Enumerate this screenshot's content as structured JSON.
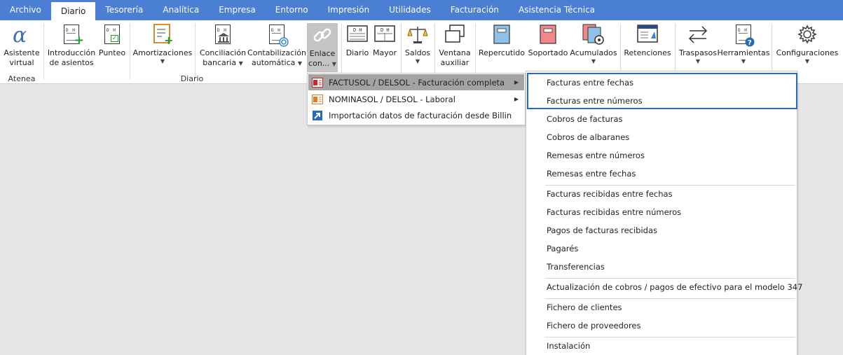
{
  "menubar": {
    "tabs": [
      {
        "label": "Archivo"
      },
      {
        "label": "Diario",
        "active": true
      },
      {
        "label": "Tesorería"
      },
      {
        "label": "Analítica"
      },
      {
        "label": "Empresa"
      },
      {
        "label": "Entorno"
      },
      {
        "label": "Impresión"
      },
      {
        "label": "Utilidades"
      },
      {
        "label": "Facturación"
      },
      {
        "label": "Asistencia Técnica"
      }
    ]
  },
  "ribbon": {
    "groups": {
      "atenea": "Atenea",
      "diario": "Diario"
    },
    "buttons": {
      "asistente": {
        "line1": "Asistente",
        "line2": "virtual"
      },
      "introduccion": {
        "line1": "Introducción",
        "line2": "de asientos"
      },
      "punteo": {
        "line1": "Punteo"
      },
      "amortizaciones": {
        "line1": "Amortizaciones"
      },
      "conciliacion": {
        "line1": "Conciliación",
        "line2": "bancaria"
      },
      "contabilizacion": {
        "line1": "Contabilización",
        "line2": "automática"
      },
      "enlace": {
        "line1": "Enlace",
        "line2": "con..."
      },
      "diario": {
        "line1": "Diario"
      },
      "mayor": {
        "line1": "Mayor"
      },
      "saldos": {
        "line1": "Saldos"
      },
      "ventana": {
        "line1": "Ventana",
        "line2": "auxiliar"
      },
      "repercutido": {
        "line1": "Repercutido"
      },
      "soportado": {
        "line1": "Soportado"
      },
      "acumulados": {
        "line1": "Acumulados"
      },
      "retenciones": {
        "line1": "Retenciones"
      },
      "traspasos": {
        "line1": "Traspasos"
      },
      "herramientas": {
        "line1": "Herramientas"
      },
      "configuraciones": {
        "line1": "Configuraciones"
      }
    },
    "doc_letters": "D H"
  },
  "enlace_menu": {
    "items": [
      {
        "label": "FACTUSOL / DELSOL - Facturación completa"
      },
      {
        "label": "NOMINASOL / DELSOL - Laboral"
      },
      {
        "label": "Importación datos de facturación desde Billin"
      }
    ]
  },
  "factusol_submenu": {
    "items": [
      {
        "label": "Facturas entre fechas"
      },
      {
        "label": "Facturas entre números"
      },
      {
        "label": "Cobros de facturas"
      },
      {
        "label": "Cobros de albaranes"
      },
      {
        "label": "Remesas entre números"
      },
      {
        "label": "Remesas entre fechas"
      },
      {
        "label": "Facturas recibidas entre fechas"
      },
      {
        "label": "Facturas recibidas entre números"
      },
      {
        "label": "Pagos de facturas recibidas"
      },
      {
        "label": "Pagarés"
      },
      {
        "label": "Transferencias"
      },
      {
        "label": "Actualización de cobros / pagos de efectivo para el modelo 347"
      },
      {
        "label": "Fichero de clientes"
      },
      {
        "label": "Fichero de proveedores"
      },
      {
        "label": "Instalación"
      }
    ]
  },
  "colors": {
    "menubar": "#4a7fd4",
    "focus": "#2a6ab3",
    "plus": "#1a9c2e"
  }
}
